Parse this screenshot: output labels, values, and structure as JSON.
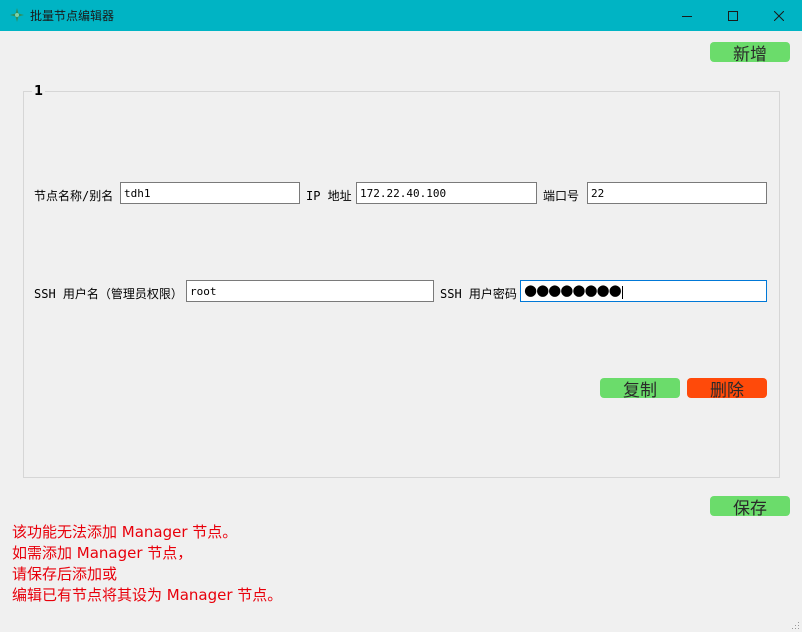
{
  "window": {
    "title": "批量节点编辑器",
    "minimize": "minimize",
    "maximize": "maximize",
    "close": "close"
  },
  "toolbar": {
    "add_label": "新增"
  },
  "node": {
    "group_title": "1",
    "name_label": "节点名称/别名",
    "name_value": "tdh1",
    "ip_label": "IP 地址",
    "ip_value": "172.22.40.100",
    "port_label": "端口号",
    "port_value": "22",
    "ssh_user_label": "SSH 用户名（管理员权限）",
    "ssh_user_value": "root",
    "ssh_pass_label": "SSH 用户密码",
    "ssh_pass_mask": "●●●●●●●●",
    "copy_label": "复制",
    "delete_label": "删除"
  },
  "footer": {
    "save_label": "保存",
    "notes": [
      "该功能无法添加 Manager 节点。",
      "如需添加 Manager 节点，",
      "请保存后添加或",
      "编辑已有节点将其设为 Manager 节点。"
    ]
  },
  "colors": {
    "titlebar": "#00b4c4",
    "green_button": "#6bdc6b",
    "red_button": "#ff4a0a",
    "note_text": "#e8000b"
  }
}
